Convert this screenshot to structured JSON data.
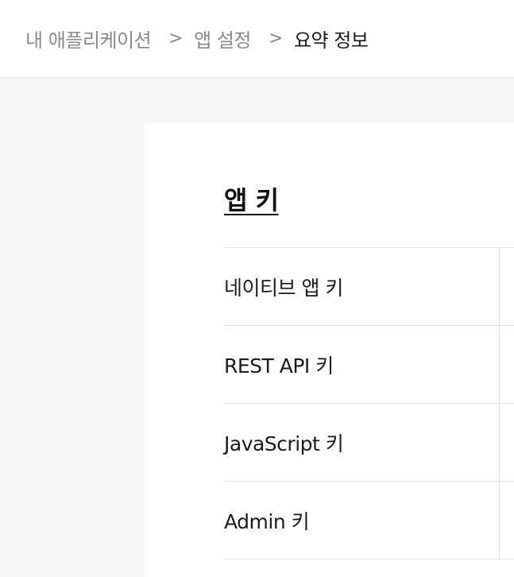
{
  "breadcrumb": {
    "items": [
      "내 애플리케이션",
      "앱 설정",
      "요약 정보"
    ],
    "separator": ">"
  },
  "section": {
    "title": "앱 키"
  },
  "key_table": {
    "rows": [
      {
        "label": "네이티브 앱 키",
        "value": ""
      },
      {
        "label": "REST API 키",
        "value": ""
      },
      {
        "label": "JavaScript 키",
        "value": ""
      },
      {
        "label": "Admin 키",
        "value": ""
      }
    ]
  },
  "colors": {
    "background": "#f5f6f6",
    "panel": "#ffffff",
    "text_primary": "#1b1b1b",
    "text_muted": "#8a8a8a",
    "divider": "#e2e4e4"
  }
}
